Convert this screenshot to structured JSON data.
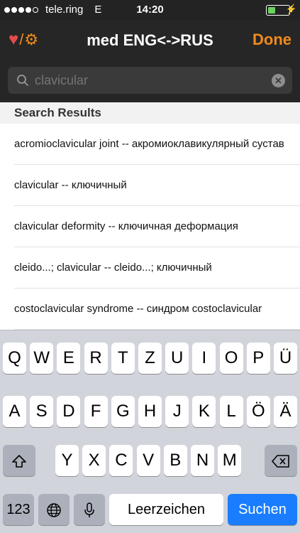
{
  "status_bar": {
    "carrier": "tele.ring",
    "network": "E",
    "time": "14:20",
    "battery_fraction": 0.35,
    "battery_color": "#6ad35c"
  },
  "nav": {
    "favorites_icon": "heart-icon",
    "settings_icon": "gear-icon",
    "title": "med ENG<->RUS",
    "done_label": "Done",
    "accent_color": "#f08a1d"
  },
  "search": {
    "placeholder": "clavicular",
    "value": ""
  },
  "results": {
    "header": "Search Results",
    "items": [
      "acromioclavicular joint -- акромиоклавикулярный сустав",
      "clavicular -- ключичный",
      "clavicular deformity -- ключичная деформация",
      "cleido...; clavicular -- cleido...; ключичный",
      "costoclavicular syndrome -- синдром costoclavicular"
    ]
  },
  "keyboard": {
    "row1": [
      "Q",
      "W",
      "E",
      "R",
      "T",
      "Z",
      "U",
      "I",
      "O",
      "P",
      "Ü"
    ],
    "row2": [
      "A",
      "S",
      "D",
      "F",
      "G",
      "H",
      "J",
      "K",
      "L",
      "Ö",
      "Ä"
    ],
    "row3": [
      "Y",
      "X",
      "C",
      "V",
      "B",
      "N",
      "M"
    ],
    "numbers_label": "123",
    "space_label": "Leerzeichen",
    "search_label": "Suchen",
    "accent_color": "#1a7dff"
  }
}
